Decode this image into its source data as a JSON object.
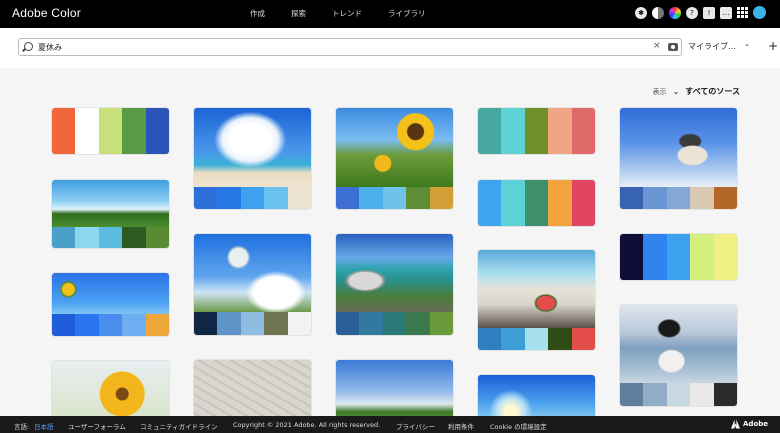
{
  "app": {
    "title": "Adobe Color"
  },
  "nav": [
    "作成",
    "探索",
    "トレンド",
    "ライブラリ"
  ],
  "search": {
    "value": "夏休み",
    "library_label": "マイライブ..."
  },
  "filter": {
    "show_label": "表示",
    "source_label": "すべてのソース"
  },
  "footer": {
    "lang_prefix": "言語:",
    "lang": "日本語",
    "forum": "ユーザーフォーラム",
    "guidelines": "コミュニティガイドライン",
    "copyright": "Copyright © 2021 Adobe. All rights reserved.",
    "privacy": "プライバシー",
    "terms": "利用条件",
    "cookie": "Cookie の環境設定",
    "brand": "Adobe"
  },
  "palettes": {
    "p1": [
      "#f0663a",
      "#ffffff",
      "#c7e07a",
      "#5a9a47",
      "#2b55b8"
    ],
    "p2": [
      "#2f6fd9",
      "#2778e6",
      "#3fa0ef",
      "#69c2ee",
      "#ebe2d2"
    ],
    "p3": [
      "#3e6fd3",
      "#4cb0ec",
      "#6fc3e9",
      "#5d8d34",
      "#d2a036"
    ],
    "p4": [
      "#46a8a1",
      "#5fd2d4",
      "#6e8f2a",
      "#f0a585",
      "#e06a6a"
    ],
    "p5": [
      "#3763b0",
      "#6a96d4",
      "#84a8d4",
      "#d9c8b2",
      "#b3682a"
    ],
    "p6": [
      "#4aa0c8",
      "#8ad7ee",
      "#5bbbe1",
      "#2e5b1f",
      "#5a8a32"
    ],
    "p7": [
      "#3ea4f0",
      "#5bd2d8",
      "#3e8f6b",
      "#f2a33e",
      "#e04562"
    ],
    "p8": [
      "#0e0e38",
      "#2f83ee",
      "#3ca2f0",
      "#d4ef7c",
      "#f0ef82"
    ],
    "p9": [
      "#1f5ed8",
      "#2a75f0",
      "#4a8fee",
      "#6eaef2",
      "#eea73a"
    ],
    "p10": [
      "#112644",
      "#5f94c8",
      "#8fbde2",
      "#6f7450",
      "#f2f2f2"
    ],
    "p11": [
      "#2a5e96",
      "#31799e",
      "#2b7a7a",
      "#3b7a4e",
      "#6a9b3a"
    ],
    "p12": [
      "#2f7fc0",
      "#3b9ed4",
      "#a6e0ee",
      "#304c16",
      "#e24d4a"
    ],
    "p13": [
      "#5e7ea0",
      "#91acc6",
      "#c8d8e0",
      "#e8e8e8",
      "#2a2a2a"
    ]
  }
}
